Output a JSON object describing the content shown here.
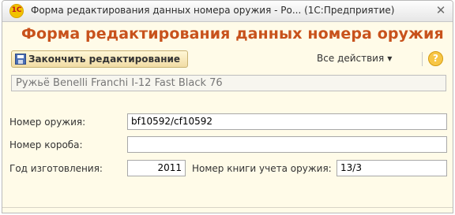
{
  "window": {
    "app_logo": "1С",
    "title": "Форма редактирования данных номера оружия - Ро...  (1С:Предприятие)",
    "close_label": "✕"
  },
  "form": {
    "heading": "Форма редактирования данных номера оружия"
  },
  "toolbar": {
    "finish_button_label": "Закончить редактирование",
    "all_actions_label": "Все действия",
    "help_label": "?"
  },
  "weapon": {
    "name": "Ружьё Benelli Franchi I-12 Fast Black 76"
  },
  "fields": {
    "weapon_number": {
      "label": "Номер оружия:",
      "value": "bf10592/cf10592"
    },
    "box_number": {
      "label": "Номер короба:",
      "value": ""
    },
    "year": {
      "label": "Год изготовления:",
      "value": "2011"
    },
    "ledger_number": {
      "label": "Номер книги учета оружия:",
      "value": "13/3"
    }
  }
}
